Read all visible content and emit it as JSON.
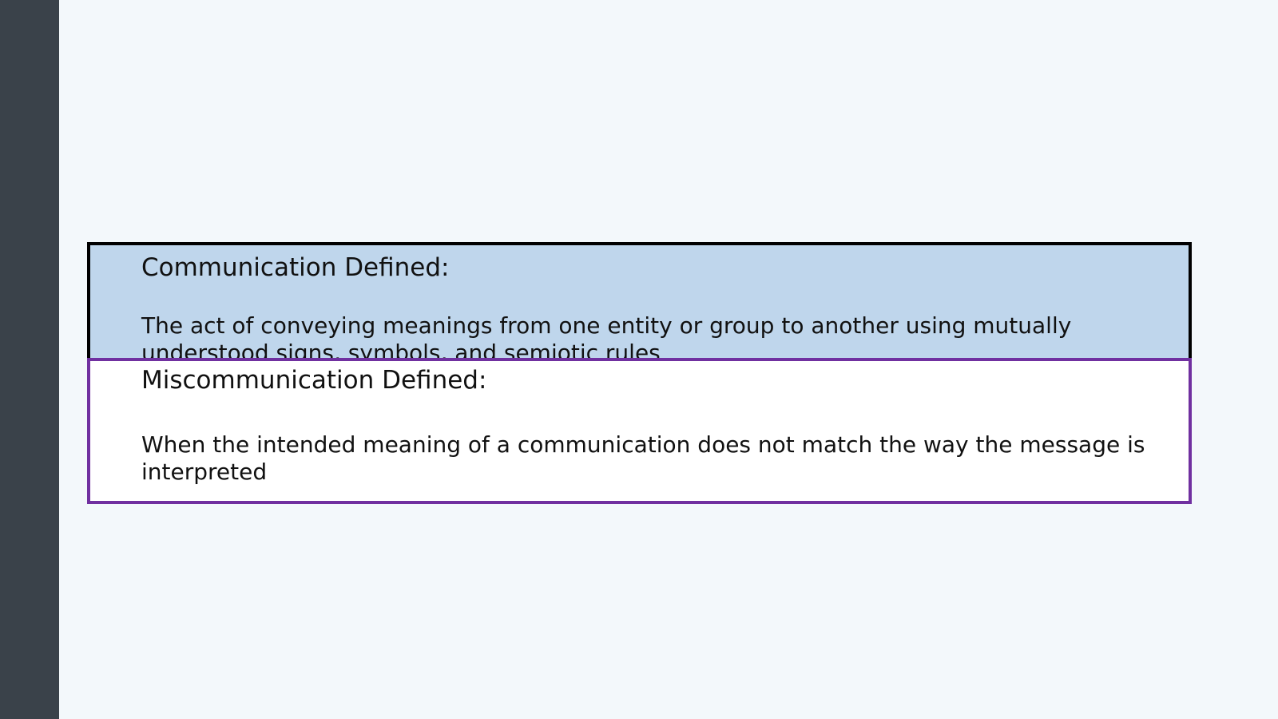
{
  "slide": {
    "communication": {
      "title": "Communication Defined:",
      "body": "The act of conveying meanings from one entity or group to another using mutually understood signs, symbols, and semiotic rules"
    },
    "miscommunication": {
      "title": "Miscommunication Defined:",
      "body": "When the intended meaning of a communication does not match the way the message is interpreted"
    }
  },
  "colors": {
    "sidebar": "#3a424a",
    "background": "#f3f8fb",
    "communication_fill": "#bfd6ec",
    "communication_border": "#000000",
    "miscommunication_fill": "#ffffff",
    "miscommunication_border": "#7030a0"
  }
}
